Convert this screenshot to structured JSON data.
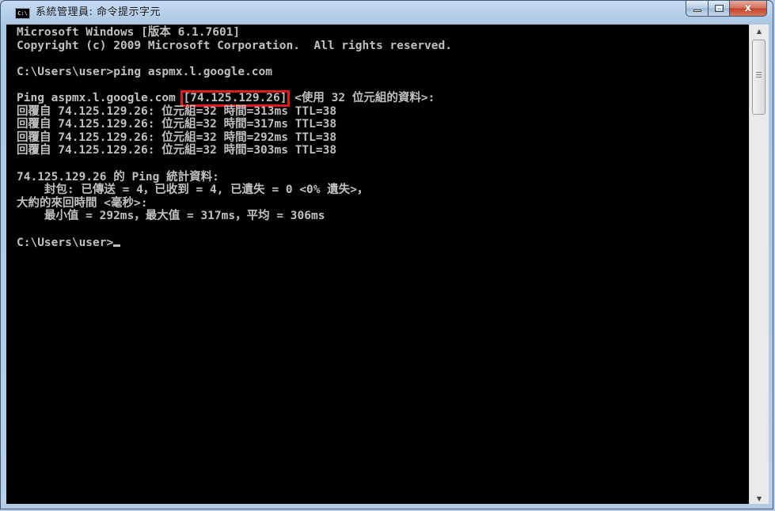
{
  "window": {
    "title": "系統管理員: 命令提示字元",
    "icon_label": "C:\\",
    "icon": "console-icon",
    "controls": {
      "minimize_icon": "minimize-icon",
      "maximize_icon": "maximize-icon",
      "close_glyph": "x",
      "close_icon": "close-icon"
    }
  },
  "colors": {
    "console_bg": "#000000",
    "console_text": "#c0c0c0",
    "highlight_box": "#e01b1b",
    "close_button": "#c4402a"
  },
  "console": {
    "lines": [
      "Microsoft Windows [版本 6.1.7601]",
      "Copyright (c) 2009 Microsoft Corporation.  All rights reserved.",
      "",
      "C:\\Users\\user>ping aspmx.l.google.com",
      "",
      {
        "before": "Ping aspmx.l.google.com ",
        "highlight": "[74.125.129.26]",
        "after": " <使用 32 位元組的資料>:"
      },
      "回覆自 74.125.129.26: 位元組=32 時間=313ms TTL=38",
      "回覆自 74.125.129.26: 位元組=32 時間=317ms TTL=38",
      "回覆自 74.125.129.26: 位元組=32 時間=292ms TTL=38",
      "回覆自 74.125.129.26: 位元組=32 時間=303ms TTL=38",
      "",
      "74.125.129.26 的 Ping 統計資料:",
      "    封包: 已傳送 = 4，已收到 = 4, 已遺失 = 0 <0% 遺失>，",
      "大約的來回時間 <毫秒>:",
      "    最小值 = 292ms，最大值 = 317ms，平均 = 306ms",
      "",
      "C:\\Users\\user>"
    ],
    "prompt_cursor": "_"
  },
  "scrollbar": {
    "up_arrow": "▲",
    "down_arrow": "▼",
    "up_icon": "scroll-up-arrow-icon",
    "down_icon": "scroll-down-arrow-icon"
  }
}
